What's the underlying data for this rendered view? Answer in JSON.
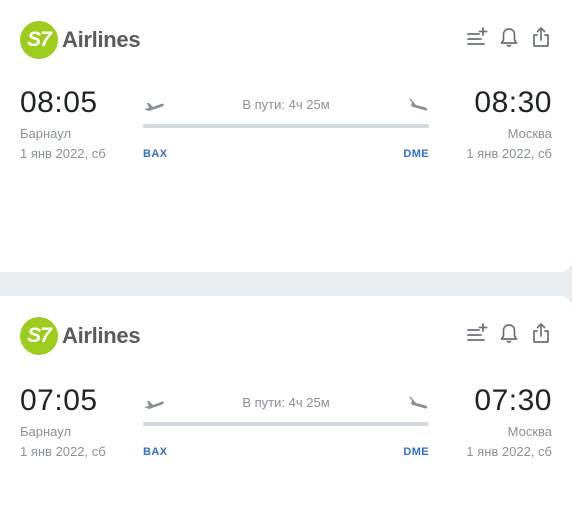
{
  "flights": [
    {
      "airline_logo_mark": "S7",
      "airline_name": "Airlines",
      "departure": {
        "time": "08:05",
        "city": "Барнаул",
        "date": "1 янв 2022, сб",
        "code": "BAX"
      },
      "arrival": {
        "time": "08:30",
        "city": "Москва",
        "date": "1 янв 2022, сб",
        "code": "DME"
      },
      "duration": "В пути: 4ч 25м",
      "icons": [
        "add-to-list-icon",
        "bell-icon",
        "share-icon"
      ]
    },
    {
      "airline_logo_mark": "S7",
      "airline_name": "Airlines",
      "departure": {
        "time": "07:05",
        "city": "Барнаул",
        "date": "1 янв 2022, сб",
        "code": "BAX"
      },
      "arrival": {
        "time": "07:30",
        "city": "Москва",
        "date": "1 янв 2022, сб",
        "code": "DME"
      },
      "duration": "В пути: 4ч 25м",
      "icons": [
        "add-to-list-icon",
        "bell-icon",
        "share-icon"
      ]
    }
  ],
  "colors": {
    "logo_green": "#9ccc1c",
    "code_blue": "#2f6fc6",
    "muted_text": "#8a9097"
  }
}
